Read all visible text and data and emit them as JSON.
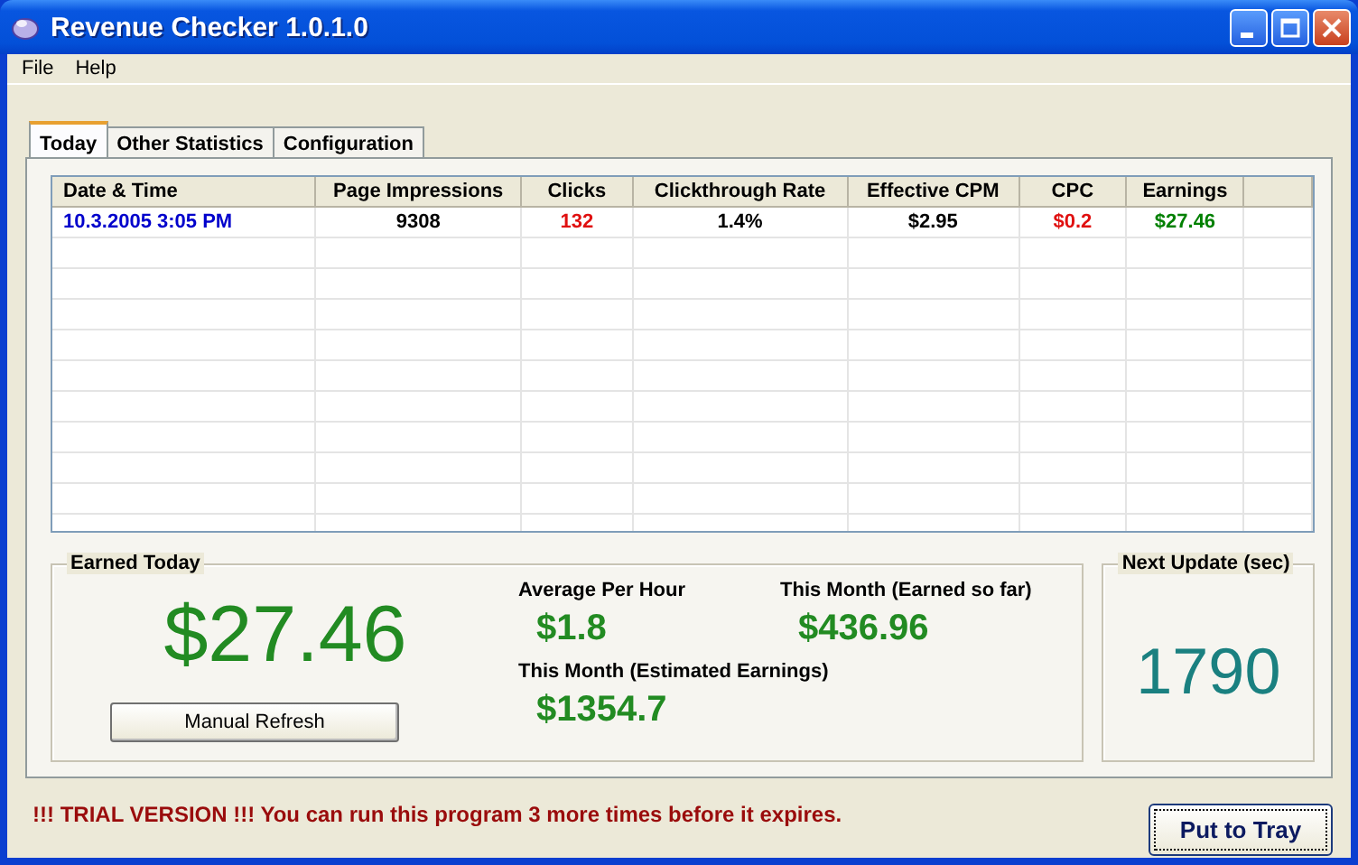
{
  "window": {
    "title": "Revenue Checker 1.0.1.0"
  },
  "menu": [
    "File",
    "Help"
  ],
  "tabs": [
    {
      "label": "Today",
      "selected": true
    },
    {
      "label": "Other Statistics",
      "selected": false
    },
    {
      "label": "Configuration",
      "selected": false
    }
  ],
  "table": {
    "columns": [
      {
        "label": "Date & Time",
        "color": "#0000cc"
      },
      {
        "label": "Page Impressions",
        "color": "#000000"
      },
      {
        "label": "Clicks",
        "color": "#e01010"
      },
      {
        "label": "Clickthrough Rate",
        "color": "#000000"
      },
      {
        "label": "Effective CPM",
        "color": "#000000"
      },
      {
        "label": "CPC",
        "color": "#e01010"
      },
      {
        "label": "Earnings",
        "color": "#008000"
      }
    ],
    "rows": [
      [
        "10.3.2005 3:05 PM",
        "9308",
        "132",
        "1.4%",
        "$2.95",
        "$0.2",
        "$27.46"
      ]
    ]
  },
  "earned_today": {
    "title": "Earned Today",
    "amount": "$27.46",
    "refresh_button": "Manual Refresh",
    "average_per_hour": {
      "label": "Average Per Hour",
      "value": "$1.8"
    },
    "month_earned": {
      "label": "This  Month (Earned so far)",
      "value": "$436.96"
    },
    "month_estimated": {
      "label": "This Month (Estimated Earnings)",
      "value": "$1354.7"
    }
  },
  "next_update": {
    "title": "Next Update (sec)",
    "value": "1790"
  },
  "trial_notice": "!!! TRIAL VERSION !!! You can run this program 3 more times before it expires.",
  "tray_button": "Put to Tray"
}
